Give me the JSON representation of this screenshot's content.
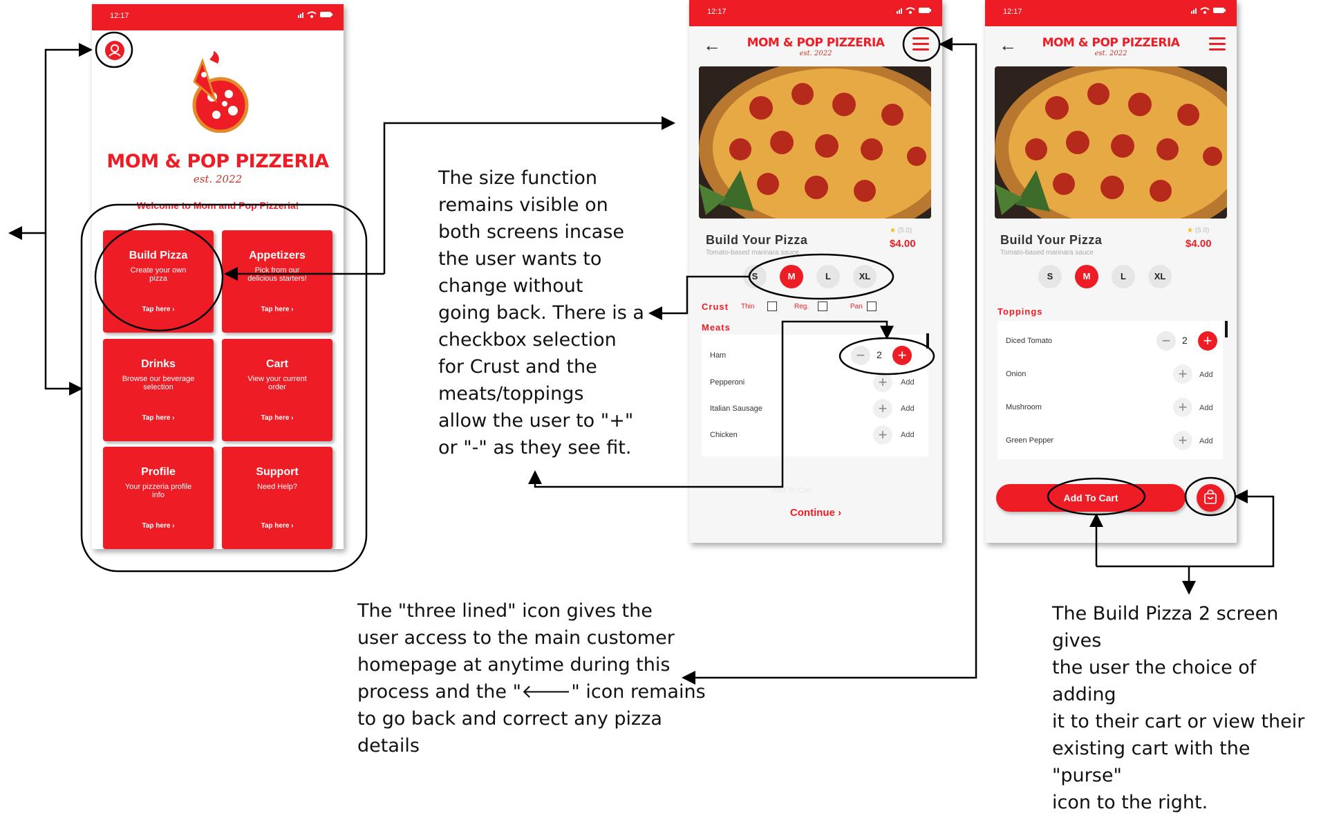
{
  "status_time": "12:17",
  "status_icons": "ᵢₗ ᯤ ▬",
  "home": {
    "brand": "MOM & POP PIZZERIA",
    "est": "est. 2022",
    "welcome": "Welcome to Mom and Pop Pizzeria!",
    "tiles": [
      {
        "title": "Build Pizza",
        "sub": "Create your own pizza",
        "tap": "Tap here  ›"
      },
      {
        "title": "Appetizers",
        "sub": "Pick from our delicious starters!",
        "tap": "Tap here  ›"
      },
      {
        "title": "Drinks",
        "sub": "Browse our beverage selection",
        "tap": "Tap here ›"
      },
      {
        "title": "Cart",
        "sub": "View your current order",
        "tap": "Tap here  ›"
      },
      {
        "title": "Profile",
        "sub": "Your pizzeria profile info",
        "tap": "Tap here ›"
      },
      {
        "title": "Support",
        "sub": "Need Help?",
        "tap": "Tap here  ›"
      }
    ]
  },
  "build1": {
    "brand": "MOM & POP PIZZERIA",
    "est": "est. 2022",
    "title": "Build Your Pizza",
    "subtitle": "Tomato-based marinara sauce",
    "rating": "(5.0)",
    "price": "$4.00",
    "sizes": [
      "S",
      "M",
      "L",
      "XL"
    ],
    "selected_size": "M",
    "crust_label": "Crust",
    "crust_options": [
      "Thin",
      "Reg.",
      "Pan"
    ],
    "meats_label": "Meats",
    "meats": [
      {
        "name": "Ham",
        "qty": "2"
      },
      {
        "name": "Pepperoni",
        "action": "Add"
      },
      {
        "name": "Italian Sausage",
        "action": "Add"
      },
      {
        "name": "Chicken",
        "action": "Add"
      }
    ],
    "faded_cart": "Add To Cart",
    "continue": "Continue  ›"
  },
  "build2": {
    "brand": "MOM & POP PIZZERIA",
    "est": "est. 2022",
    "title": "Build Your Pizza",
    "subtitle": "Tomato-based marinara sauce",
    "rating": "(5.0)",
    "price": "$4.00",
    "sizes": [
      "S",
      "M",
      "L",
      "XL"
    ],
    "selected_size": "M",
    "toppings_label": "Toppings",
    "toppings": [
      {
        "name": "Diced Tomato",
        "qty": "2"
      },
      {
        "name": "Onion",
        "action": "Add"
      },
      {
        "name": "Mushroom",
        "action": "Add"
      },
      {
        "name": "Green Pepper",
        "action": "Add"
      }
    ],
    "add_to_cart": "Add To Cart"
  },
  "annotations": {
    "size": [
      "The size function",
      "remains visible on",
      "both screens incase",
      "the user wants to",
      "change without",
      "going back. There is a",
      "checkbox selection",
      "for Crust and the",
      "meats/toppings",
      "allow the user to \"+\"",
      "or \"-\" as they see fit."
    ],
    "menu": [
      "The \"three lined\" icon gives the",
      "user access to the main customer",
      "homepage at anytime during this",
      "process and the \"🡐\" icon remains",
      "to go back and correct any pizza",
      "details"
    ],
    "cart": [
      "The Build Pizza 2 screen gives",
      "the user the choice of adding",
      "it to their cart or view their",
      "existing cart with the \"purse\"",
      "icon to the right."
    ]
  },
  "colors": {
    "brand_red": "#ee1c24",
    "background": "#f6f6f6"
  }
}
